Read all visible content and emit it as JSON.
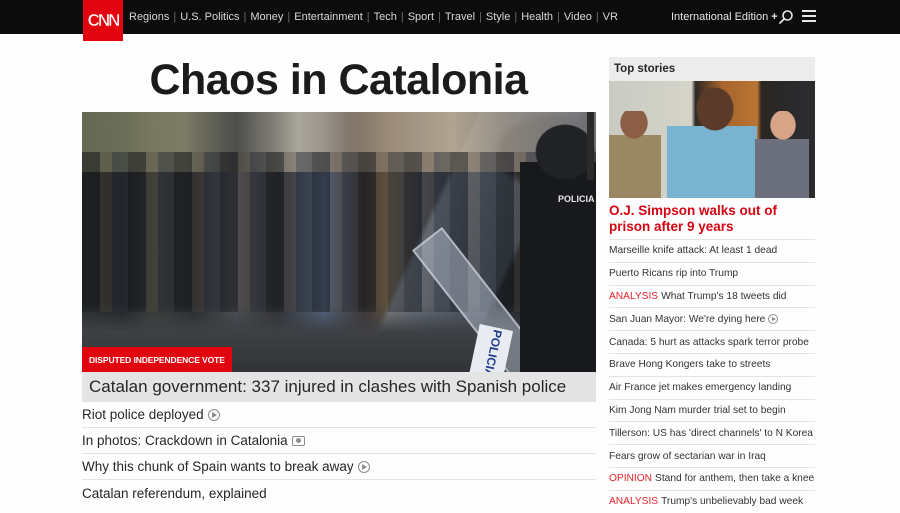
{
  "header": {
    "logo_text": "CNN",
    "nav_items": [
      "Regions",
      "U.S. Politics",
      "Money",
      "Entertainment",
      "Tech",
      "Sport",
      "Travel",
      "Style",
      "Health",
      "Video",
      "VR"
    ],
    "edition_label": "International Edition",
    "edition_plus": "+",
    "search_icon": "search-icon",
    "menu_icon": "hamburger-menu-icon"
  },
  "main": {
    "headline": "Chaos in Catalonia",
    "hero": {
      "image_description": "Protesters facing Spanish riot police in Barcelona",
      "shield_text": "POLICIA",
      "officer_text": "POLICIA",
      "kicker": "DISPUTED INDEPENDENCE VOTE",
      "caption": "Catalan government: 337 injured in clashes with Spanish police"
    },
    "related": [
      {
        "text": "Riot police deployed",
        "icon": "play-icon"
      },
      {
        "text": "In photos: Crackdown in Catalonia",
        "icon": "camera-icon"
      },
      {
        "text": "Why this chunk of Spain wants to break away",
        "icon": "play-icon"
      },
      {
        "text": "Catalan referendum, explained",
        "icon": ""
      }
    ]
  },
  "sidebar": {
    "title": "Top stories",
    "lead_image_description": "O.J. Simpson at parole hearing",
    "lead_headline": "O.J. Simpson walks out of prison after 9 years",
    "stories": [
      {
        "label": "",
        "text": "Marseille knife attack: At least 1 dead",
        "icon": ""
      },
      {
        "label": "",
        "text": "Puerto Ricans rip into Trump",
        "icon": ""
      },
      {
        "label": "ANALYSIS",
        "text": "What Trump's 18 tweets did",
        "icon": ""
      },
      {
        "label": "",
        "text": "San Juan Mayor: We're dying here",
        "icon": "play-icon"
      },
      {
        "label": "",
        "text": "Canada: 5 hurt as attacks spark terror probe",
        "icon": ""
      },
      {
        "label": "",
        "text": "Brave Hong Kongers take to streets",
        "icon": ""
      },
      {
        "label": "",
        "text": "Air France jet makes emergency landing",
        "icon": ""
      },
      {
        "label": "",
        "text": "Kim Jong Nam murder trial set to begin",
        "icon": ""
      },
      {
        "label": "",
        "text": "Tillerson: US has 'direct channels' to N Korea",
        "icon": ""
      },
      {
        "label": "",
        "text": "Fears grow of sectarian war in Iraq",
        "icon": ""
      },
      {
        "label": "OPINION",
        "text": "Stand for anthem, then take a knee",
        "icon": ""
      },
      {
        "label": "ANALYSIS",
        "text": "Trump's unbelievably bad week",
        "icon": ""
      }
    ]
  },
  "colors": {
    "brand_red": "#e2040e",
    "nav_bg": "#0c0c0c",
    "lead_red": "#d30511",
    "label_red": "#e4242c"
  }
}
